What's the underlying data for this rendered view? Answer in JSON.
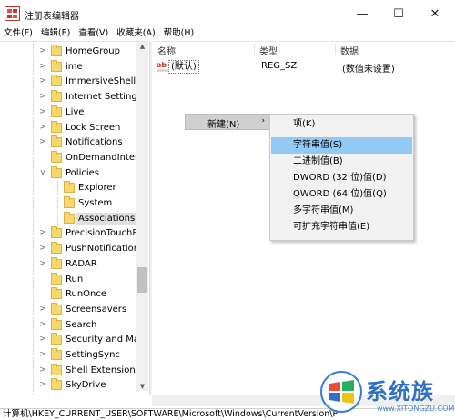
{
  "window": {
    "title": "注册表编辑器",
    "minimize_glyph": "—",
    "maximize_glyph": "☐",
    "close_glyph": "✕"
  },
  "menu": [
    "文件(F)",
    "编辑(E)",
    "查看(V)",
    "收藏夹(A)",
    "帮助(H)"
  ],
  "tree": {
    "items": [
      {
        "label": "HomeGroup",
        "expander": ">"
      },
      {
        "label": "ime",
        "expander": ">"
      },
      {
        "label": "ImmersiveShell",
        "expander": ">"
      },
      {
        "label": "Internet Settings",
        "expander": ">"
      },
      {
        "label": "Live",
        "expander": ">"
      },
      {
        "label": "Lock Screen",
        "expander": ">"
      },
      {
        "label": "Notifications",
        "expander": ">"
      },
      {
        "label": "OnDemandInterfac",
        "expander": ""
      },
      {
        "label": "Policies",
        "expander": "v"
      },
      {
        "label": "Explorer",
        "expander": ""
      },
      {
        "label": "System",
        "expander": ""
      },
      {
        "label": "Associations",
        "expander": "",
        "selected": true
      },
      {
        "label": "PrecisionTouchPac",
        "expander": ">"
      },
      {
        "label": "PushNotifications",
        "expander": ">"
      },
      {
        "label": "RADAR",
        "expander": ">"
      },
      {
        "label": "Run",
        "expander": ""
      },
      {
        "label": "RunOnce",
        "expander": ""
      },
      {
        "label": "Screensavers",
        "expander": ">"
      },
      {
        "label": "Search",
        "expander": ">"
      },
      {
        "label": "Security and Maint",
        "expander": ">"
      },
      {
        "label": "SettingSync",
        "expander": ">"
      },
      {
        "label": "Shell Extensions",
        "expander": ">"
      },
      {
        "label": "SkyDrive",
        "expander": ">"
      }
    ],
    "scroll_up": "▲",
    "scroll_down": "▼"
  },
  "list": {
    "columns": [
      "名称",
      "类型",
      "数据"
    ],
    "rows": [
      {
        "icon": "ab",
        "name": "(默认)",
        "type": "REG_SZ",
        "data": "(数值未设置)"
      }
    ]
  },
  "context_menu": {
    "new_label": "新建(N)",
    "new_arrow": "›",
    "submenu": [
      {
        "label": "项(K)"
      },
      {
        "label": "字符串值(S)",
        "highlighted": true
      },
      {
        "label": "二进制值(B)"
      },
      {
        "label": "DWORD (32 位)值(D)"
      },
      {
        "label": "QWORD (64 位)值(Q)"
      },
      {
        "label": "多字符串值(M)"
      },
      {
        "label": "可扩充字符串值(E)"
      }
    ]
  },
  "statusbar": {
    "path": "计算机\\HKEY_CURRENT_USER\\SOFTWARE\\Microsoft\\Windows\\CurrentVersion\\P"
  },
  "watermark": {
    "brand": "系统族",
    "url": "www.XITONGZU.COM"
  },
  "colors": {
    "highlight": "#91c9f7",
    "folder": "#f7d86b",
    "brand": "#2f6fc4"
  }
}
